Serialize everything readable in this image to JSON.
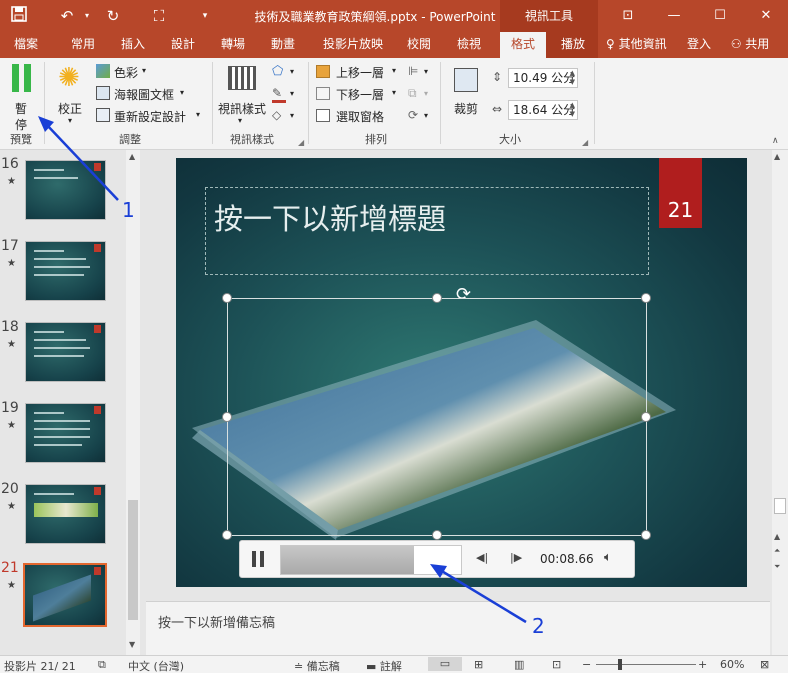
{
  "window": {
    "doc_title": "技術及職業教育政策綱領.pptx - PowerPoint",
    "context_title": "視訊工具"
  },
  "tabs": [
    {
      "label": "檔案"
    },
    {
      "label": "常用"
    },
    {
      "label": "插入"
    },
    {
      "label": "設計"
    },
    {
      "label": "轉場"
    },
    {
      "label": "動畫"
    },
    {
      "label": "投影片放映"
    },
    {
      "label": "校閱"
    },
    {
      "label": "檢視"
    },
    {
      "label": "格式"
    },
    {
      "label": "播放"
    }
  ],
  "tell_me": "其他資訊",
  "sign_in": "登入",
  "share": "共用",
  "ribbon": {
    "preview": {
      "pause_label_1": "暫",
      "pause_label_2": "停",
      "group": "預覽"
    },
    "adjust": {
      "correct": "校正",
      "color": "色彩",
      "poster_frame": "海報圖文框",
      "reset_design": "重新設定設計",
      "group": "調整"
    },
    "video_styles": {
      "styles": "視訊樣式",
      "group": "視訊樣式"
    },
    "arrange": {
      "bring_forward": "上移一層",
      "send_backward": "下移一層",
      "selection_pane": "選取窗格",
      "group": "排列"
    },
    "size": {
      "crop": "裁剪",
      "height": "10.49 公分",
      "width": "18.64 公分",
      "group": "大小"
    }
  },
  "thumbnails": [
    {
      "num": "16",
      "star": "★"
    },
    {
      "num": "17",
      "star": "★"
    },
    {
      "num": "18",
      "star": "★"
    },
    {
      "num": "19",
      "star": "★"
    },
    {
      "num": "20",
      "star": "★"
    },
    {
      "num": "21",
      "star": "★"
    }
  ],
  "slide": {
    "number": "21",
    "title_placeholder": "按一下以新增標題"
  },
  "player": {
    "time": "00:08.66",
    "progress": 0.74
  },
  "notes_placeholder": "按一下以新增備忘稿",
  "status": {
    "slide_count": "投影片 21/ 21",
    "language": "中文 (台灣)",
    "notes": "備忘稿",
    "comments": "註解",
    "zoom": "60%"
  },
  "annotations": {
    "label_1": "1",
    "label_2": "2"
  },
  "colors": {
    "accent": "#b7472a",
    "annotation": "#1a3fd6",
    "slide_number_tag": "#b01e1e"
  }
}
